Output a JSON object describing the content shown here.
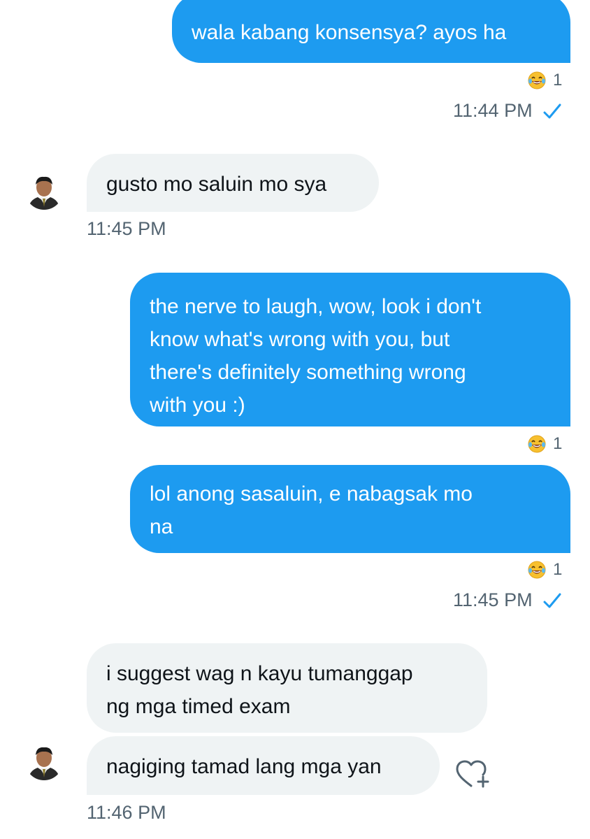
{
  "messages": [
    {
      "from": "me",
      "text": "wala kabang konsensya? ayos ha",
      "reaction": {
        "emoji": "face-with-tears-of-joy",
        "count": "1"
      },
      "time": "11:44 PM",
      "status": "sent"
    },
    {
      "from": "them",
      "text": "gusto mo saluin mo sya",
      "time": "11:45 PM"
    },
    {
      "from": "me",
      "text": "the nerve to laugh, wow, look i don't\nknow what's wrong with you, but\nthere's definitely something wrong\nwith you :)",
      "reaction": {
        "emoji": "face-with-tears-of-joy",
        "count": "1"
      }
    },
    {
      "from": "me",
      "text": "lol anong sasaluin, e nabagsak mo\nna",
      "reaction": {
        "emoji": "face-with-tears-of-joy",
        "count": "1"
      },
      "time": "11:45 PM",
      "status": "sent"
    },
    {
      "from": "them",
      "text": "i suggest wag n kayu tumanggap\nng mga timed exam"
    },
    {
      "from": "them",
      "text": "nagiging tamad lang mga yan",
      "time": "11:46 PM",
      "action_icon": "heart-plus-icon"
    }
  ],
  "colors": {
    "sent_bubble": "#1d9bf0",
    "received_bubble": "#eff3f4",
    "secondary_text": "#536471",
    "check": "#1d9bf0"
  }
}
